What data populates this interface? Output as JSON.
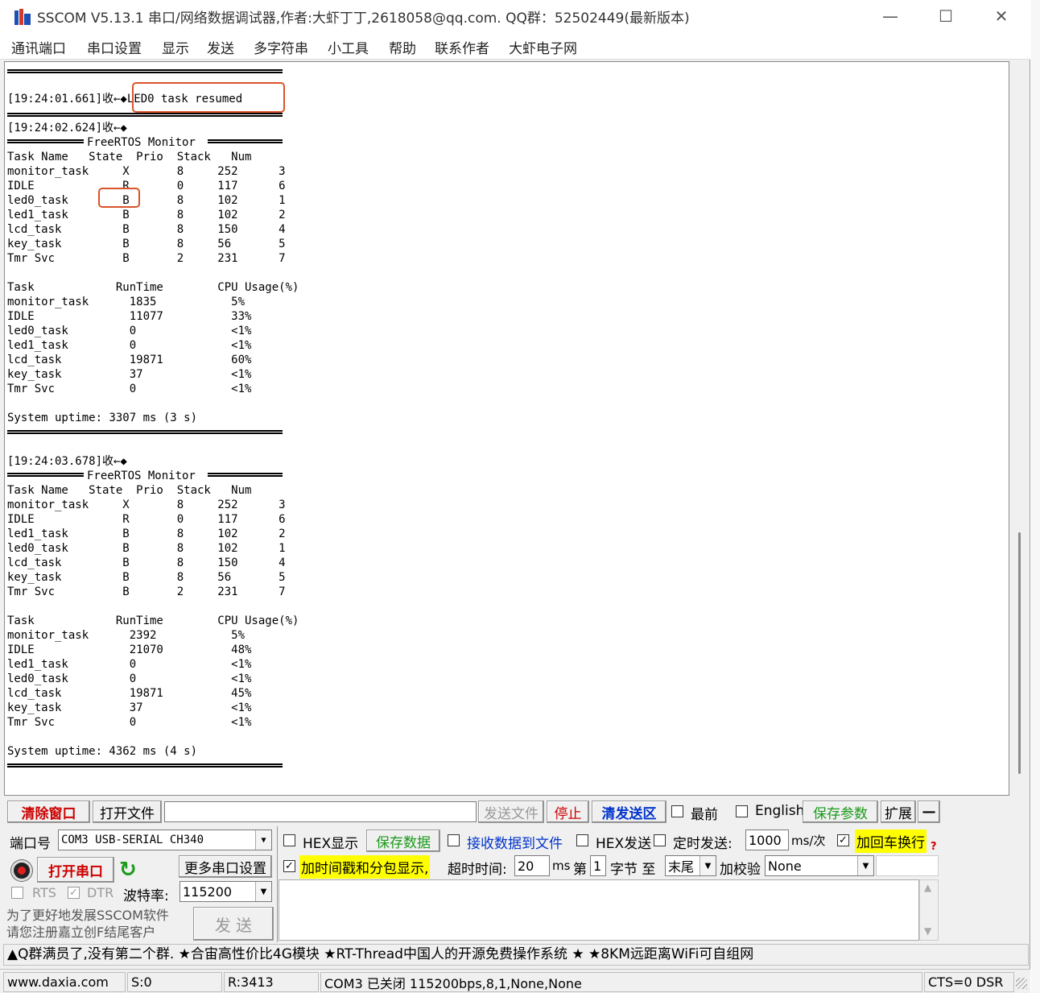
{
  "window": {
    "title": "SSCOM V5.13.1 串口/网络数据调试器,作者:大虾丁丁,2618058@qq.com. QQ群：52502449(最新版本)",
    "minimize": "—",
    "maximize": "☐",
    "close": "✕"
  },
  "menu": [
    "通讯端口",
    "串口设置",
    "显示",
    "发送",
    "多字符串",
    "小工具",
    "帮助",
    "联系作者",
    "大虾电子网"
  ],
  "receive": {
    "msg1": "[19:24:01.661]收←◆LED0 task resumed",
    "block1": {
      "header": "[19:24:02.624]收←◆",
      "title": "FreeRTOS Monitor",
      "task_columns": "Task Name   State  Prio  Stack   Num",
      "tasks": [
        "monitor_task     X       8     252      3",
        "IDLE             R       0     117      6",
        "led0_task        B       8     102      1",
        "led1_task        B       8     102      2",
        "lcd_task         B       8     150      4",
        "key_task         B       8     56       5",
        "Tmr Svc          B       2     231      7"
      ],
      "runtime_columns": "Task            RunTime        CPU Usage(%)",
      "runtimes": [
        "monitor_task      1835           5%",
        "IDLE              11077          33%",
        "led0_task         0              <1%",
        "led1_task         0              <1%",
        "lcd_task          19871          60%",
        "key_task          37             <1%",
        "Tmr Svc           0              <1%"
      ],
      "uptime": "System uptime: 3307 ms (3 s)"
    },
    "block2": {
      "header": "[19:24:03.678]收←◆",
      "title": "FreeRTOS Monitor",
      "task_columns": "Task Name   State  Prio  Stack   Num",
      "tasks": [
        "monitor_task     X       8     252      3",
        "IDLE             R       0     117      6",
        "led1_task        B       8     102      2",
        "led0_task        B       8     102      1",
        "lcd_task         B       8     150      4",
        "key_task         B       8     56       5",
        "Tmr Svc          B       2     231      7"
      ],
      "runtime_columns": "Task            RunTime        CPU Usage(%)",
      "runtimes": [
        "monitor_task      2392           5%",
        "IDLE              21070          48%",
        "led1_task         0              <1%",
        "led0_task         0              <1%",
        "lcd_task          19871          45%",
        "key_task          37             <1%",
        "Tmr Svc           0              <1%"
      ],
      "uptime": "System uptime: 4362 ms (4 s)"
    }
  },
  "toolbar": {
    "clear": "清除窗口",
    "open_file": "打开文件",
    "file_path": "",
    "send_file": "发送文件",
    "stop": "停止",
    "clear_send": "清发送区",
    "topmost": "最前",
    "english": "English",
    "save_params": "保存参数",
    "expand": "扩展",
    "collapse": "—"
  },
  "port": {
    "port_label": "端口号",
    "port_value": "COM3 USB-SERIAL CH340",
    "open_port": "打开串口",
    "more_settings": "更多串口设置",
    "rts": "RTS",
    "dtr": "DTR",
    "baud_label": "波特率:",
    "baud_value": "115200",
    "hex_display": "HEX显示",
    "save_data": "保存数据",
    "recv_to_file": "接收数据到文件",
    "hex_send": "HEX发送",
    "timed_send": "定时发送:",
    "interval": "1000",
    "interval_unit": "ms/次",
    "add_crlf": "加回车换行",
    "timestamp": "加时间戳和分包显示,",
    "timeout_label": "超时时间:",
    "timeout_value": "20",
    "timeout_unit": "ms",
    "nth_label": "第",
    "nth_value": "1",
    "byte_label": "字节 至",
    "tail_value": "末尾",
    "checksum_label": "加校验",
    "checksum_value": "None",
    "promo": "为了更好地发展SSCOM软件\n请您注册嘉立创F结尾客户",
    "send": "发 送"
  },
  "ticker": "▲Q群满员了,没有第二个群. ★合宙高性价比4G模块 ★RT-Thread中国人的开源免费操作系统 ★ ★8KM远距离WiFi可自组网",
  "status": {
    "site": "www.daxia.com",
    "sent": "S:0",
    "received": "R:3413",
    "port_state": "COM3 已关闭  115200bps,8,1,None,None",
    "lines": "CTS=0 DSR"
  },
  "colors": {
    "highlight_box": "#d9532b",
    "accent_blue": "#0033cc",
    "accent_green": "#1a9a1a",
    "accent_red": "#cc0000",
    "yellow": "#ffff00"
  }
}
